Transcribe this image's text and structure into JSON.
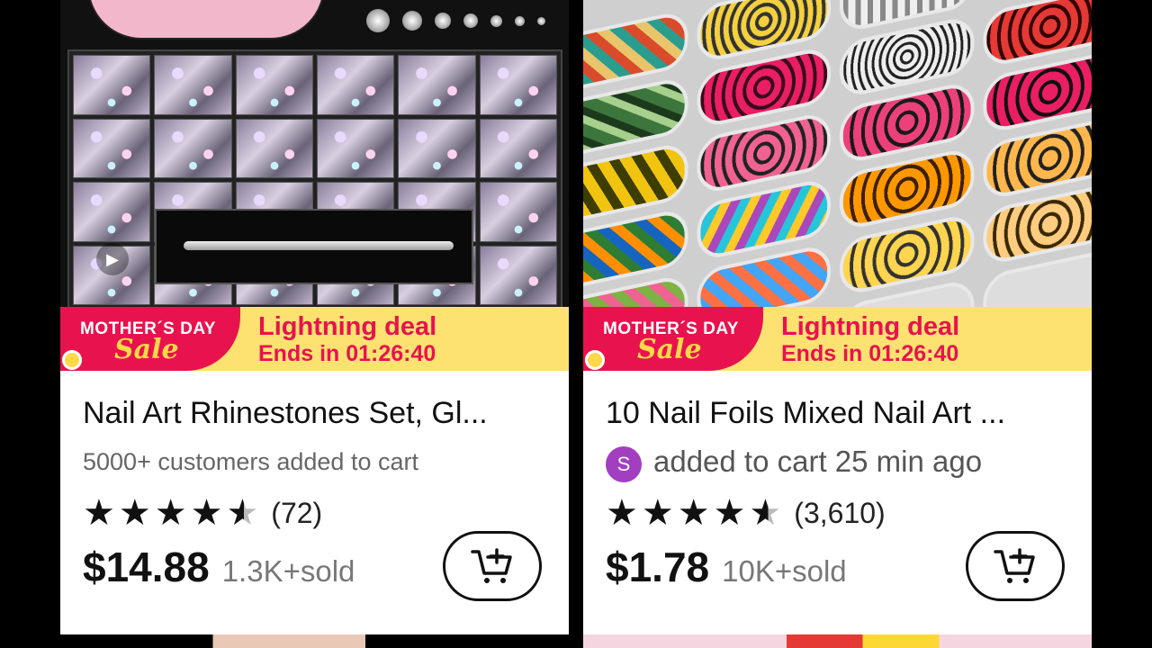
{
  "products": [
    {
      "image_icon": "rhinestone-tray-image",
      "play_icon": "play-icon",
      "banner": {
        "badge_top": "MOTHER´S DAY",
        "badge_script": "Sale",
        "deal": "Lightning deal",
        "countdown": "Ends in 01:26:40"
      },
      "title": "Nail Art Rhinestones Set, Gl...",
      "social_text": "5000+ customers added to cart",
      "rating_display": "4.5 stars",
      "reviews": "(72)",
      "price": "$14.88",
      "sold": "1.3K+sold"
    },
    {
      "image_icon": "nail-foils-image",
      "banner": {
        "badge_top": "MOTHER´S DAY",
        "badge_script": "Sale",
        "deal": "Lightning deal",
        "countdown": "Ends in 01:26:40"
      },
      "title": "10 Nail Foils Mixed Nail Art ...",
      "avatar_letter": "S",
      "social_text": "added to cart 25 min ago",
      "rating_display": "4.5 stars",
      "reviews": "(3,610)",
      "price": "$1.78",
      "sold": "10K+sold"
    }
  ],
  "colors": {
    "sale_red": "#e8124f",
    "deal_yellow": "#fde271",
    "avatar_purple": "#a13fc0"
  }
}
